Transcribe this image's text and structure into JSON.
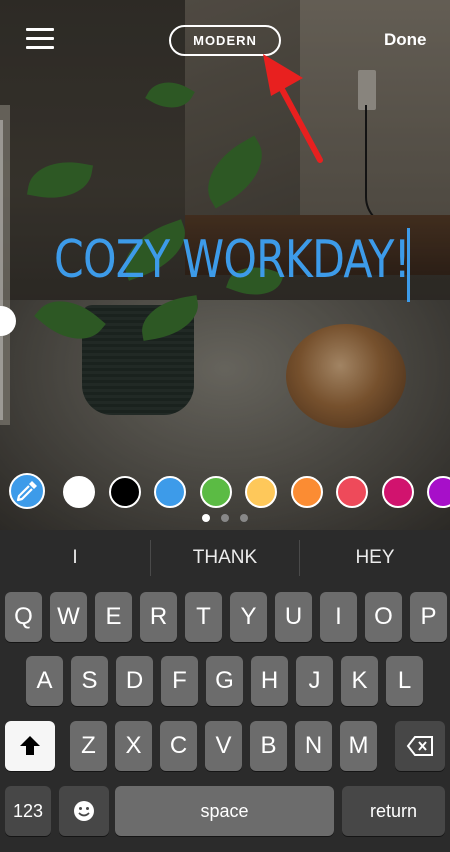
{
  "header": {
    "menu_icon": "hamburger-menu-icon",
    "font_style_label": "MODERN",
    "done_label": "Done"
  },
  "story": {
    "text": "COZY WORKDAY!",
    "text_color": "#3d9be9"
  },
  "palette": {
    "eyedropper_icon": "eyedropper-icon",
    "colors": [
      "#ffffff",
      "#000000",
      "#3d9be9",
      "#5bbb44",
      "#fec85a",
      "#fb8c33",
      "#ee4a5a",
      "#d1136e",
      "#a70fc9"
    ],
    "page_count": 3,
    "current_page": 1
  },
  "suggestions": [
    "I",
    "THANK",
    "HEY"
  ],
  "keyboard": {
    "row1": [
      "Q",
      "W",
      "E",
      "R",
      "T",
      "Y",
      "U",
      "I",
      "O",
      "P"
    ],
    "row2": [
      "A",
      "S",
      "D",
      "F",
      "G",
      "H",
      "J",
      "K",
      "L"
    ],
    "row3": [
      "Z",
      "X",
      "C",
      "V",
      "B",
      "N",
      "M"
    ],
    "numbers_label": "123",
    "space_label": "space",
    "return_label": "return",
    "shift_icon": "shift-icon",
    "delete_icon": "backspace-icon",
    "emoji_icon": "emoji-icon"
  }
}
